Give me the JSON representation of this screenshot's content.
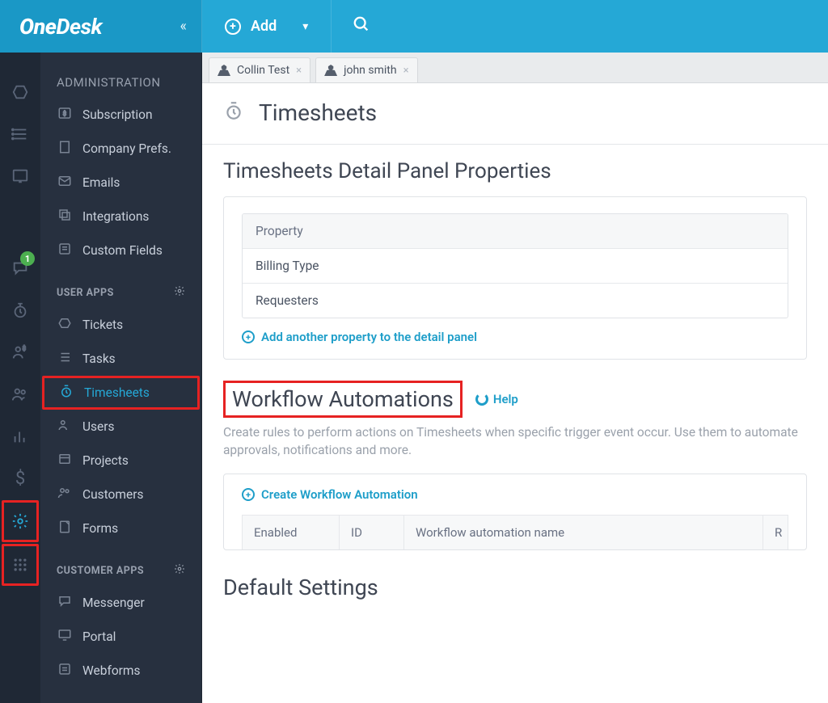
{
  "brand": {
    "name_part1": "One",
    "name_part2": "Desk"
  },
  "topbar": {
    "add_label": "Add",
    "notify_count": "1"
  },
  "sidebar": {
    "section_admin": "ADMINISTRATION",
    "admin_items": [
      {
        "label": "Subscription"
      },
      {
        "label": "Company Prefs."
      },
      {
        "label": "Emails"
      },
      {
        "label": "Integrations"
      },
      {
        "label": "Custom Fields"
      }
    ],
    "section_user_apps": "USER APPS",
    "user_app_items": [
      {
        "label": "Tickets"
      },
      {
        "label": "Tasks"
      },
      {
        "label": "Timesheets"
      },
      {
        "label": "Users"
      },
      {
        "label": "Projects"
      },
      {
        "label": "Customers"
      },
      {
        "label": "Forms"
      }
    ],
    "section_customer_apps": "CUSTOMER APPS",
    "customer_app_items": [
      {
        "label": "Messenger"
      },
      {
        "label": "Portal"
      },
      {
        "label": "Webforms"
      }
    ]
  },
  "tabs": [
    {
      "label": "Collin Test"
    },
    {
      "label": "john smith"
    }
  ],
  "page": {
    "title": "Timesheets",
    "section_detail_title": "Timesheets Detail Panel Properties",
    "property_header": "Property",
    "properties": [
      {
        "label": "Billing Type"
      },
      {
        "label": "Requesters"
      }
    ],
    "add_property_label": "Add another property to the detail panel",
    "wf_title": "Workflow Automations",
    "help_label": "Help",
    "wf_desc": "Create rules to perform actions on Timesheets when specific trigger event occur. Use them to automate approvals, notifications and more.",
    "create_wf_label": "Create Workflow Automation",
    "wf_cols": {
      "enabled": "Enabled",
      "id": "ID",
      "name": "Workflow automation name",
      "r": "R"
    },
    "default_settings_title": "Default Settings"
  }
}
